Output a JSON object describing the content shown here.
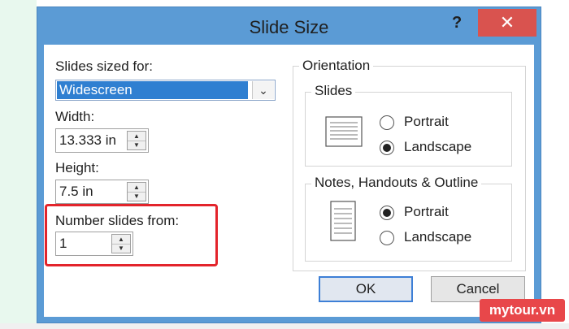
{
  "dialog": {
    "title": "Slide Size",
    "help_label": "?",
    "close_label": "✕"
  },
  "sizing": {
    "sized_for_label": "Slides sized for:",
    "sized_for_value": "Widescreen",
    "width_label": "Width:",
    "width_value": "13.333 in",
    "height_label": "Height:",
    "height_value": "7.5 in",
    "number_from_label": "Number slides from:",
    "number_from_value": "1"
  },
  "orientation": {
    "title": "Orientation",
    "slides": {
      "title": "Slides",
      "options": [
        {
          "label": "Portrait",
          "selected": false
        },
        {
          "label": "Landscape",
          "selected": true
        }
      ]
    },
    "notes": {
      "title": "Notes, Handouts & Outline",
      "options": [
        {
          "label": "Portrait",
          "selected": true
        },
        {
          "label": "Landscape",
          "selected": false
        }
      ]
    }
  },
  "buttons": {
    "ok": "OK",
    "cancel": "Cancel"
  },
  "watermark": "mytour.vn",
  "colors": {
    "titlebar": "#5b9bd5",
    "close": "#d9534f",
    "highlight": "#e3242b",
    "selection": "#2f7fd1"
  },
  "icons": {
    "dropdown": "chevron-down-icon",
    "spin": "spin-arrows-icon",
    "slide_landscape": "landscape-page-icon",
    "slide_portrait": "portrait-page-icon"
  }
}
